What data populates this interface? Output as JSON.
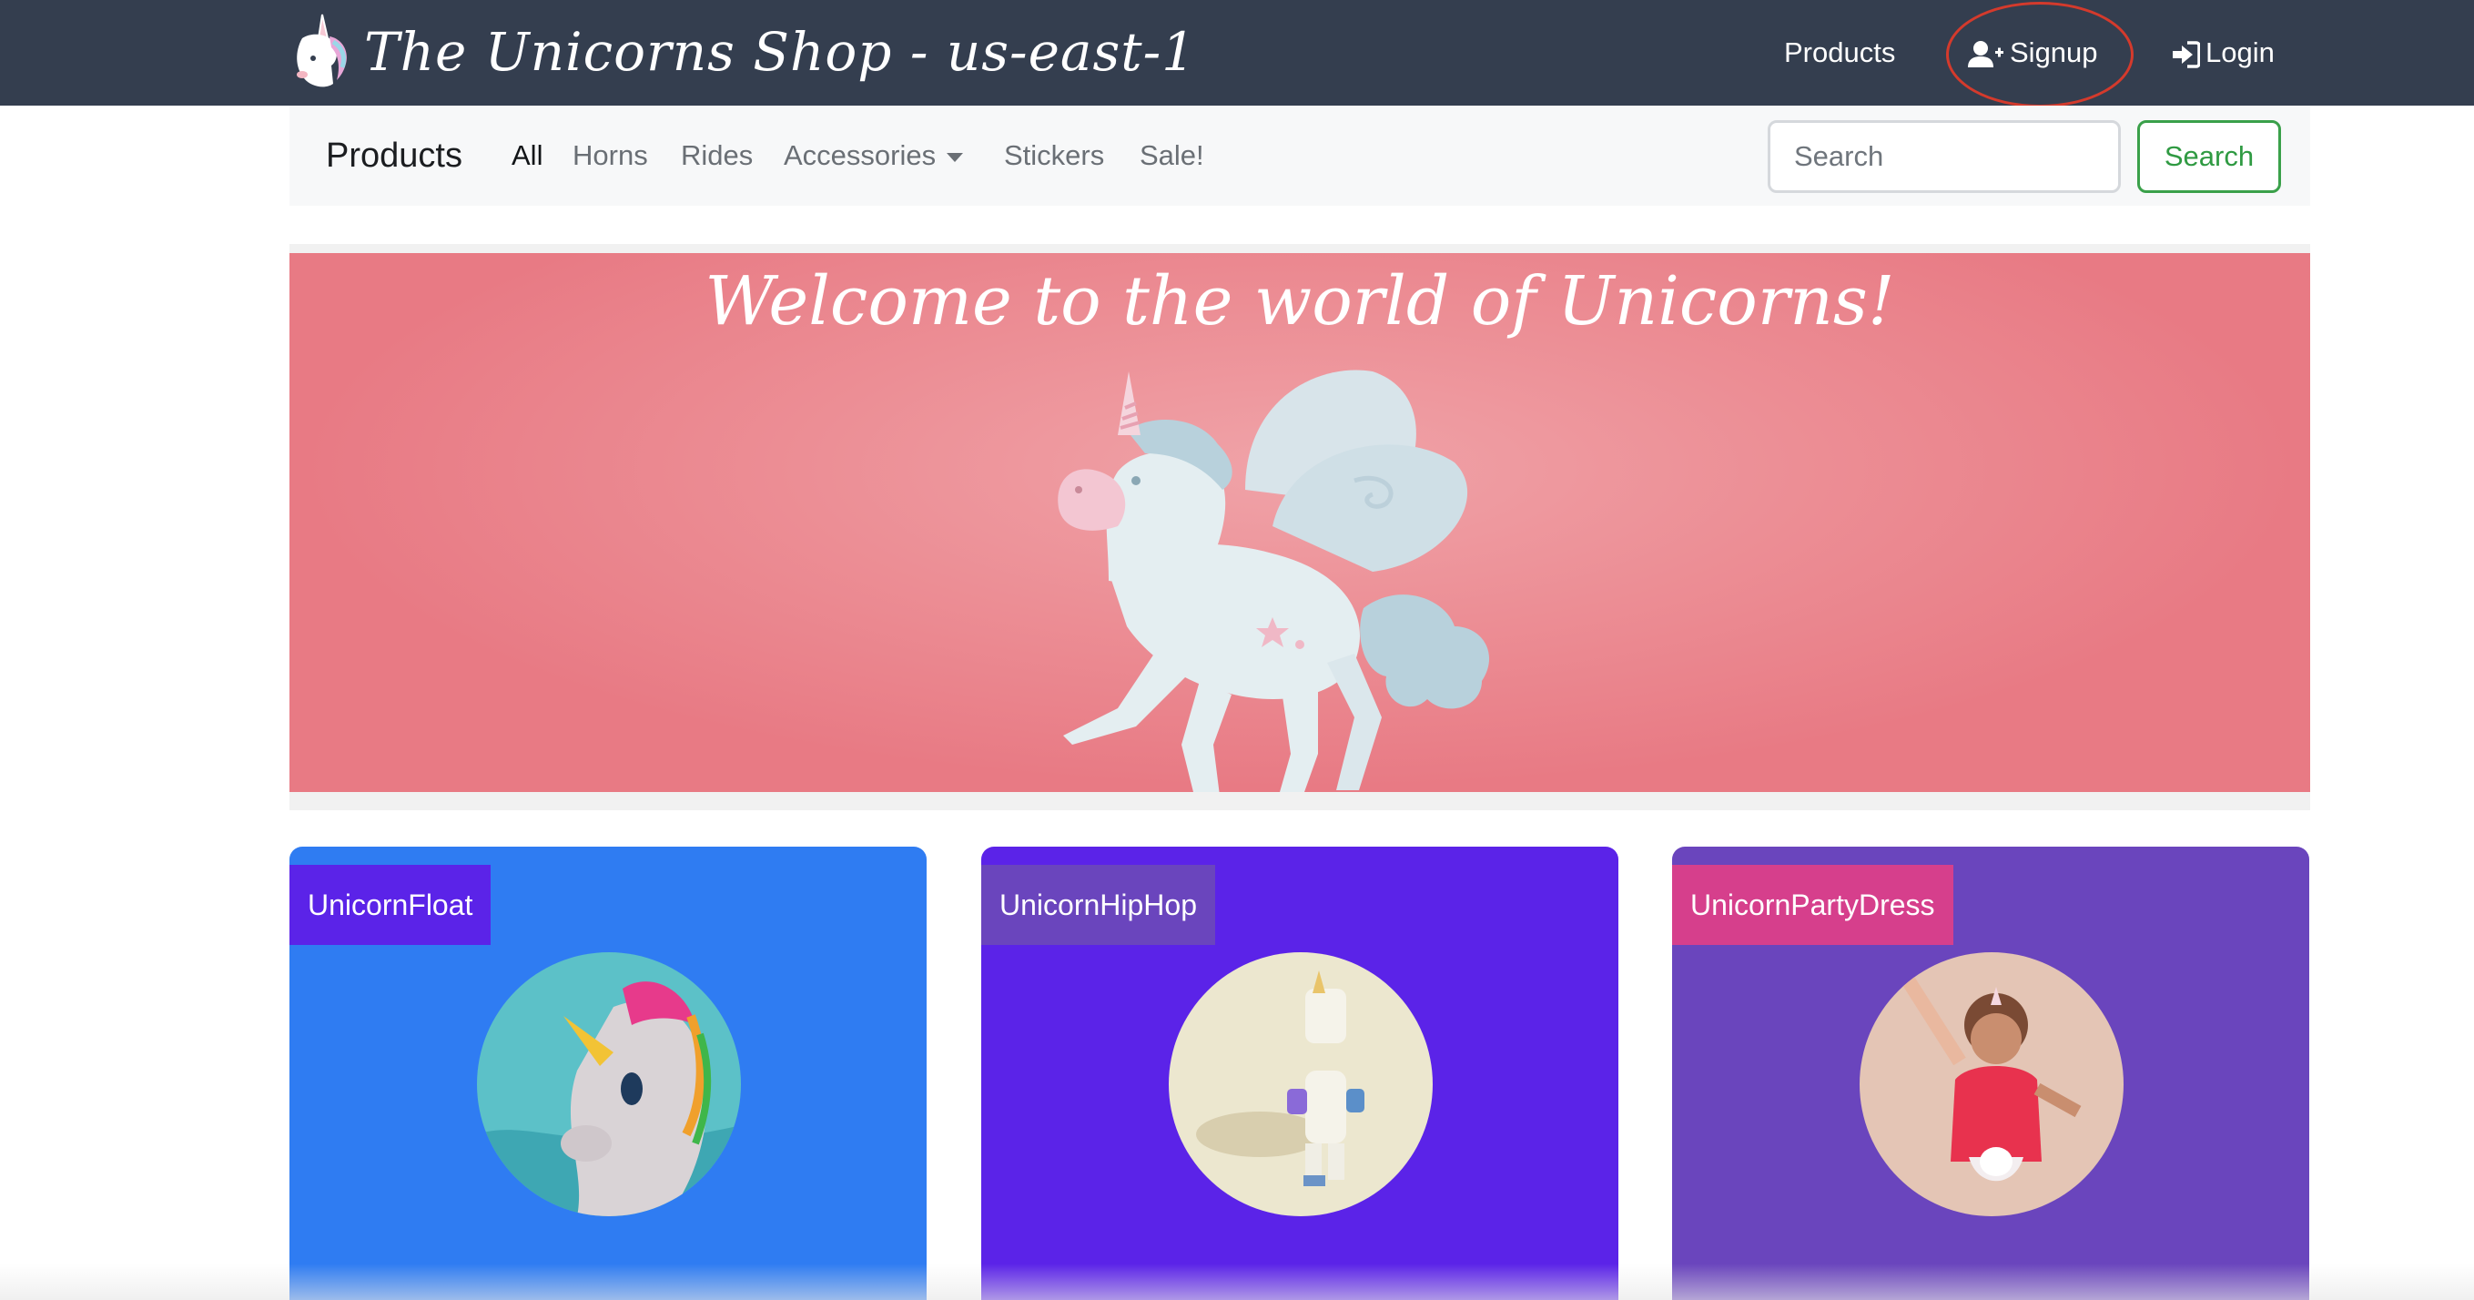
{
  "header": {
    "brand_title": "The Unicorns Shop - us-east-1",
    "nav": {
      "products": "Products",
      "signup": "Signup",
      "login": "Login"
    }
  },
  "subnav": {
    "brand": "Products",
    "categories": [
      {
        "label": "All",
        "active": true
      },
      {
        "label": "Horns",
        "active": false
      },
      {
        "label": "Rides",
        "active": false
      },
      {
        "label": "Accessories",
        "active": false,
        "dropdown": true
      },
      {
        "label": "Stickers",
        "active": false
      },
      {
        "label": "Sale!",
        "active": false
      }
    ],
    "search": {
      "placeholder": "Search",
      "value": "",
      "button_label": "Search"
    }
  },
  "hero": {
    "title": "Welcome to the world of Unicorns!"
  },
  "products": [
    {
      "name": "UnicornFloat",
      "card_color": "#2f7cf2",
      "label_color": "#5b23e8"
    },
    {
      "name": "UnicornHipHop",
      "card_color": "#5b23e8",
      "label_color": "#6a45bd"
    },
    {
      "name": "UnicornPartyDress",
      "card_color": "#6a45bd",
      "label_color": "#d63f8c"
    }
  ],
  "icons": {
    "brand": "unicorn-head-icon",
    "signup": "user-plus-icon",
    "login": "sign-in-icon",
    "dropdown": "caret-down-icon"
  },
  "colors": {
    "navbar": "#343e4f",
    "subnav": "#f7f8f9",
    "hero": "#ec8e95",
    "search_button": "#2f9a42",
    "highlight": "#d43a2c"
  }
}
